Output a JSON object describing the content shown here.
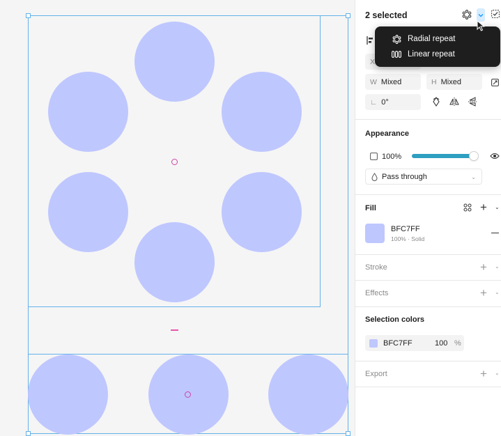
{
  "colors": {
    "fill": "#BFC7FF",
    "selection": "#63B1EA",
    "accent": "#0D99FF",
    "center_marker": "#CC44AA",
    "dropdown_bg": "#1E1E1E"
  },
  "header": {
    "title": "2 selected",
    "repeat_icon": "radial-repeat-icon",
    "chevron_icon": "chevron-down-icon",
    "checkbox_icon": "select-matching-icon"
  },
  "dropdown": {
    "items": [
      {
        "label": "Radial repeat",
        "icon": "radial-repeat-icon"
      },
      {
        "label": "Linear repeat",
        "icon": "linear-repeat-icon"
      }
    ]
  },
  "layout_props": {
    "x_prefix": "X",
    "w_prefix": "W",
    "w_value": "Mixed",
    "h_prefix": "H",
    "h_value": "Mixed",
    "rotation_value": "0°"
  },
  "appearance": {
    "title": "Appearance",
    "opacity": "100%",
    "opacity_fraction": 1.0,
    "blend_mode": "Pass through"
  },
  "fill": {
    "title": "Fill",
    "hex": "BFC7FF",
    "details": "100% · Solid"
  },
  "stroke": {
    "title": "Stroke"
  },
  "effects": {
    "title": "Effects"
  },
  "selection_colors": {
    "title": "Selection colors",
    "hex": "BFC7FF",
    "opacity": "100",
    "unit": "%"
  },
  "export": {
    "title": "Export"
  }
}
